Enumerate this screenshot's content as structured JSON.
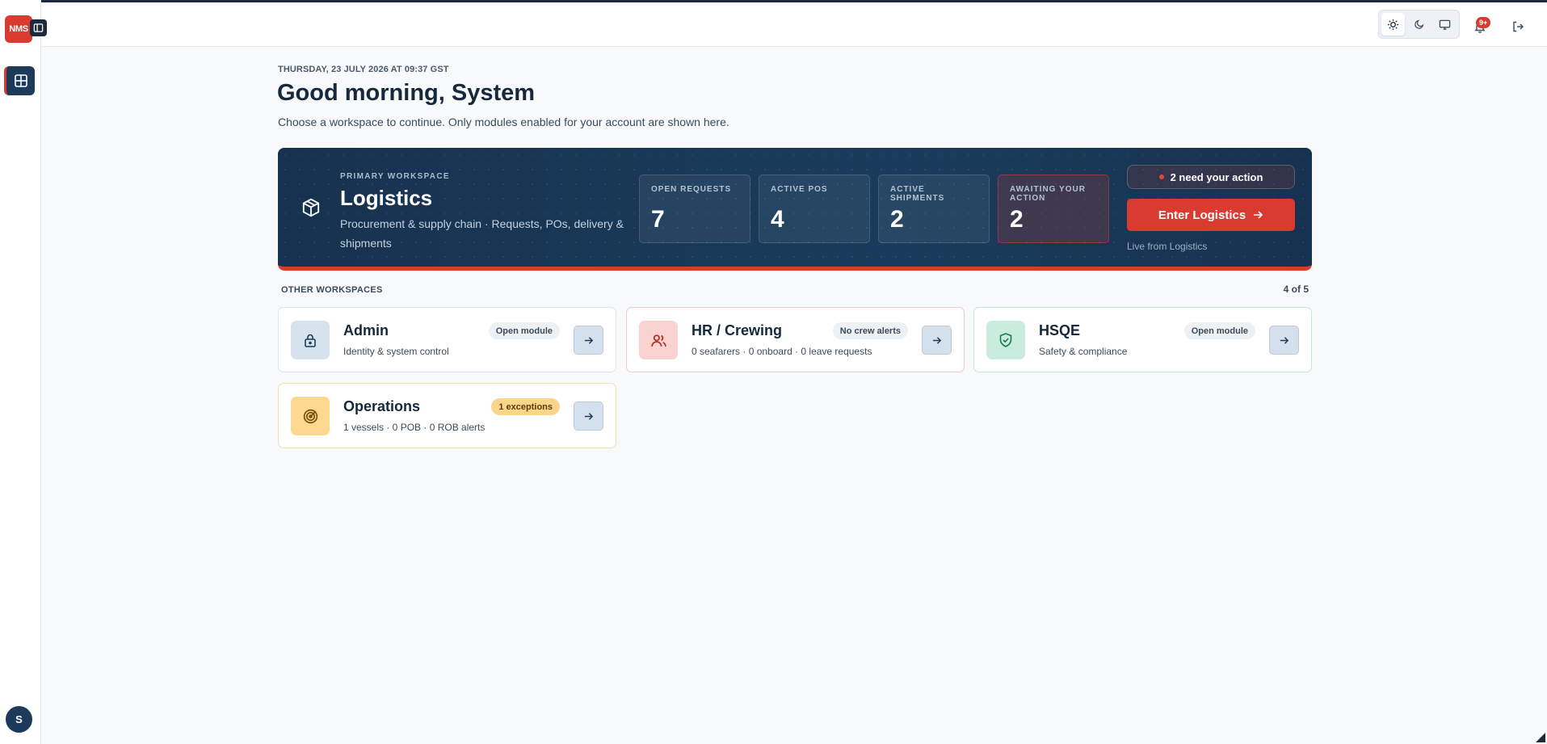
{
  "brand": {
    "logo_text": "NMS",
    "accent": "#d93b30",
    "navy": "#17324f"
  },
  "sidebar": {
    "items": [
      {
        "name": "workspaces",
        "icon": "grid-icon",
        "active": true
      }
    ],
    "avatar_initial": "S"
  },
  "topbar": {
    "theme_options": [
      {
        "name": "light",
        "icon": "sun-icon",
        "active": true
      },
      {
        "name": "dark",
        "icon": "moon-icon",
        "active": false
      },
      {
        "name": "system",
        "icon": "monitor-icon",
        "active": false
      }
    ],
    "notifications_badge": "9+",
    "logout_icon": "logout-icon"
  },
  "header": {
    "dateline": "THURSDAY, 23 JULY 2026 AT 09:37 GST",
    "greeting": "Good morning, System",
    "subtitle": "Choose a workspace to continue. Only modules enabled for your account are shown here."
  },
  "primary": {
    "eyebrow": "PRIMARY WORKSPACE",
    "title": "Logistics",
    "description": "Procurement & supply chain · Requests, POs, delivery & shipments",
    "icon": "box-icon",
    "stats": [
      {
        "label": "OPEN REQUESTS",
        "value": "7",
        "alert": false
      },
      {
        "label": "ACTIVE POS",
        "value": "4",
        "alert": false
      },
      {
        "label": "ACTIVE SHIPMENTS",
        "value": "2",
        "alert": false
      },
      {
        "label": "AWAITING YOUR ACTION",
        "value": "2",
        "alert": true
      }
    ],
    "need_action": "2 need your action",
    "enter_label": "Enter Logistics",
    "live_from": "Live from Logistics"
  },
  "other": {
    "title": "OTHER WORKSPACES",
    "count": "4 of 5",
    "cards": [
      {
        "title": "Admin",
        "description": "Identity & system control",
        "badge": "Open module",
        "icon": "lock-icon",
        "icon_bg": "#d6e3ef",
        "icon_color": "#1e3a5a"
      },
      {
        "title": "HR / Crewing",
        "description": "0 seafarers · 0 onboard · 0 leave requests",
        "badge": "No crew alerts",
        "icon": "users-icon",
        "icon_bg": "#f8d3cf",
        "icon_color": "#b32c22"
      },
      {
        "title": "HSQE",
        "description": "Safety & compliance",
        "badge": "Open module",
        "icon": "shield-check-icon",
        "icon_bg": "#c9ecdf",
        "icon_color": "#1a7a56"
      },
      {
        "title": "Operations",
        "description": "1 vessels · 0 POB · 0 ROB alerts",
        "badge": "1 exceptions",
        "icon": "radar-icon",
        "icon_bg": "#fcd98f",
        "icon_color": "#7a4d05"
      }
    ]
  }
}
